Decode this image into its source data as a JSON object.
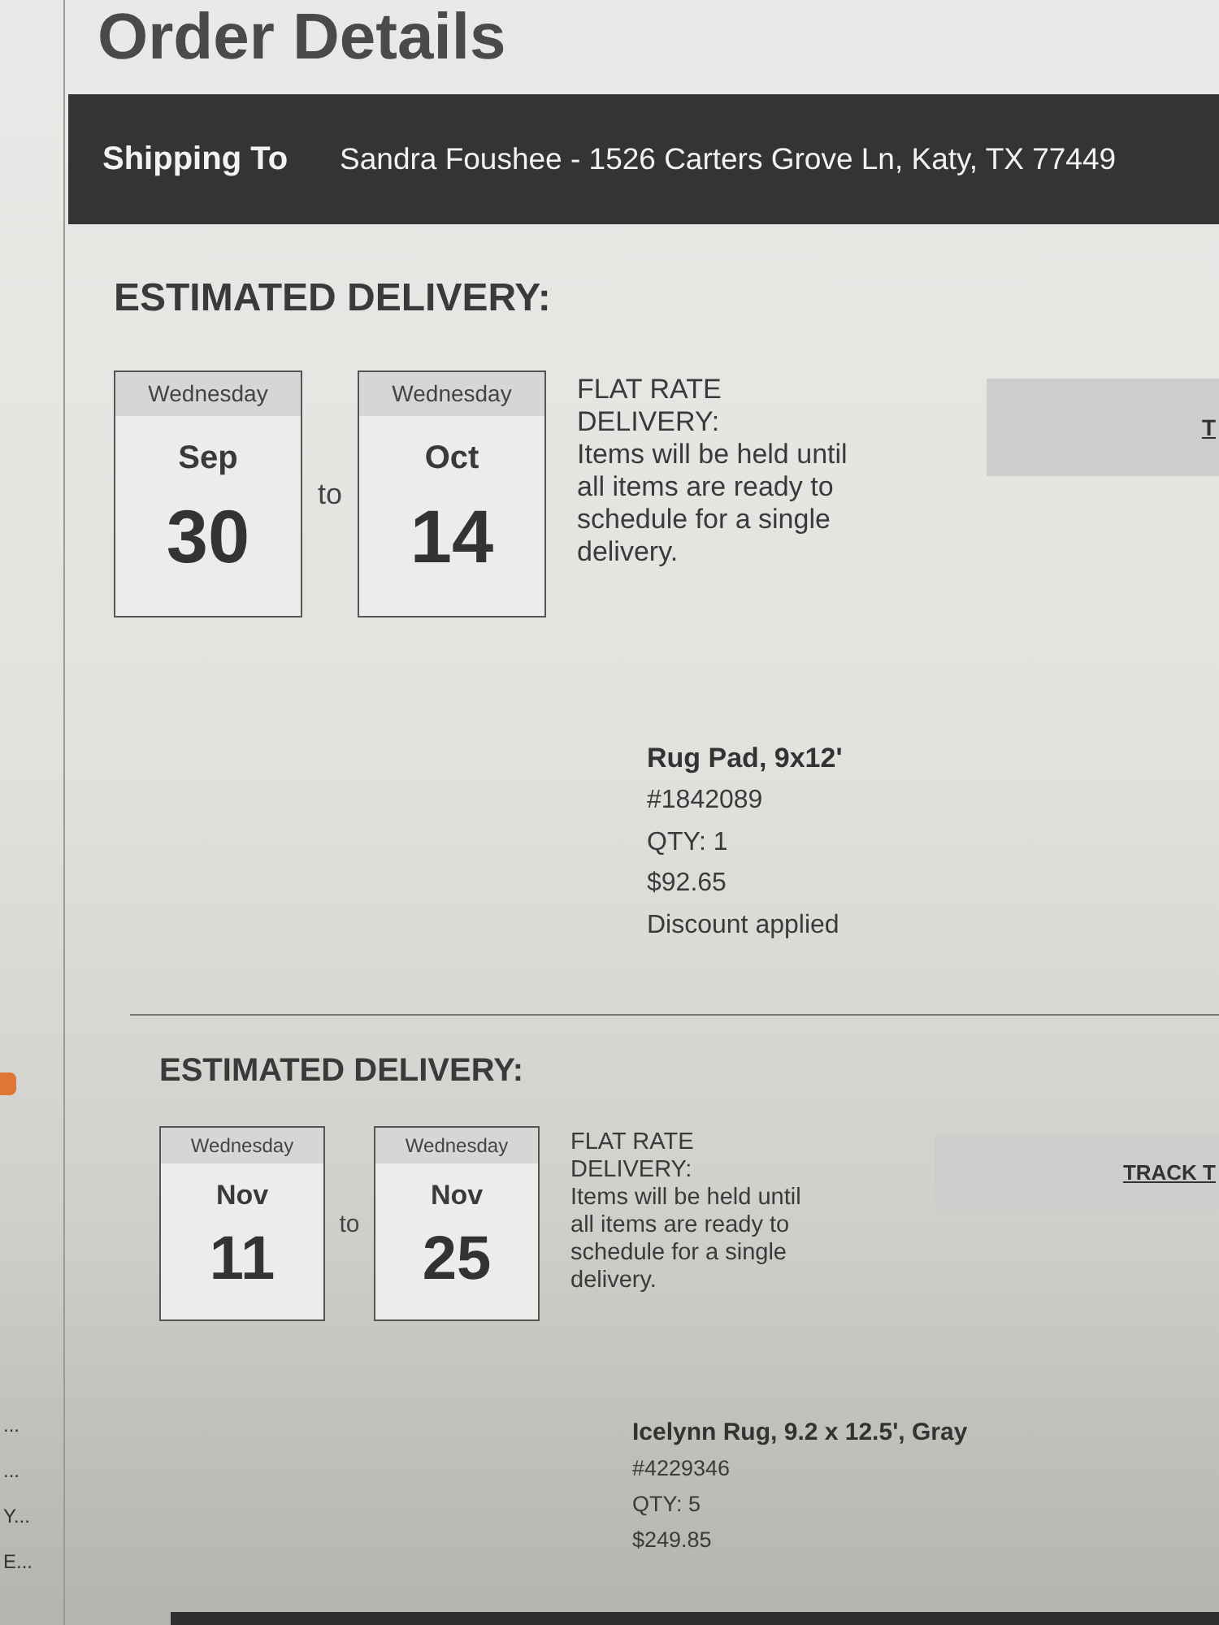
{
  "page_title": "Order Details",
  "shipping": {
    "label": "Shipping To",
    "address": "Sandra Foushee - 1526 Carters Grove Ln, Katy, TX 77449"
  },
  "shipments": [
    {
      "heading": "ESTIMATED DELIVERY:",
      "from": {
        "weekday": "Wednesday",
        "month": "Sep",
        "day": "30"
      },
      "separator": "to",
      "to": {
        "weekday": "Wednesday",
        "month": "Oct",
        "day": "14"
      },
      "method": "FLAT RATE DELIVERY:",
      "note": "Items will be held until all items are ready to schedule for a single delivery.",
      "track_button": "T",
      "items": [
        {
          "name": "Rug Pad, 9x12'",
          "sku": "#1842089",
          "qty": "QTY: 1",
          "price": "$92.65",
          "discount": "Discount applied"
        }
      ]
    },
    {
      "heading": "ESTIMATED DELIVERY:",
      "from": {
        "weekday": "Wednesday",
        "month": "Nov",
        "day": "11"
      },
      "separator": "to",
      "to": {
        "weekday": "Wednesday",
        "month": "Nov",
        "day": "25"
      },
      "method": "FLAT RATE DELIVERY:",
      "note": "Items will be held until all items are ready to schedule for a single delivery.",
      "track_button": "TRACK T",
      "items": [
        {
          "name": "Icelynn Rug, 9.2 x 12.5', Gray",
          "sku": "#4229346",
          "qty": "QTY: 5",
          "price": "$249.85"
        }
      ]
    }
  ],
  "left_panel": {
    "items": [
      "...",
      "...",
      "Y...",
      "E..."
    ]
  }
}
